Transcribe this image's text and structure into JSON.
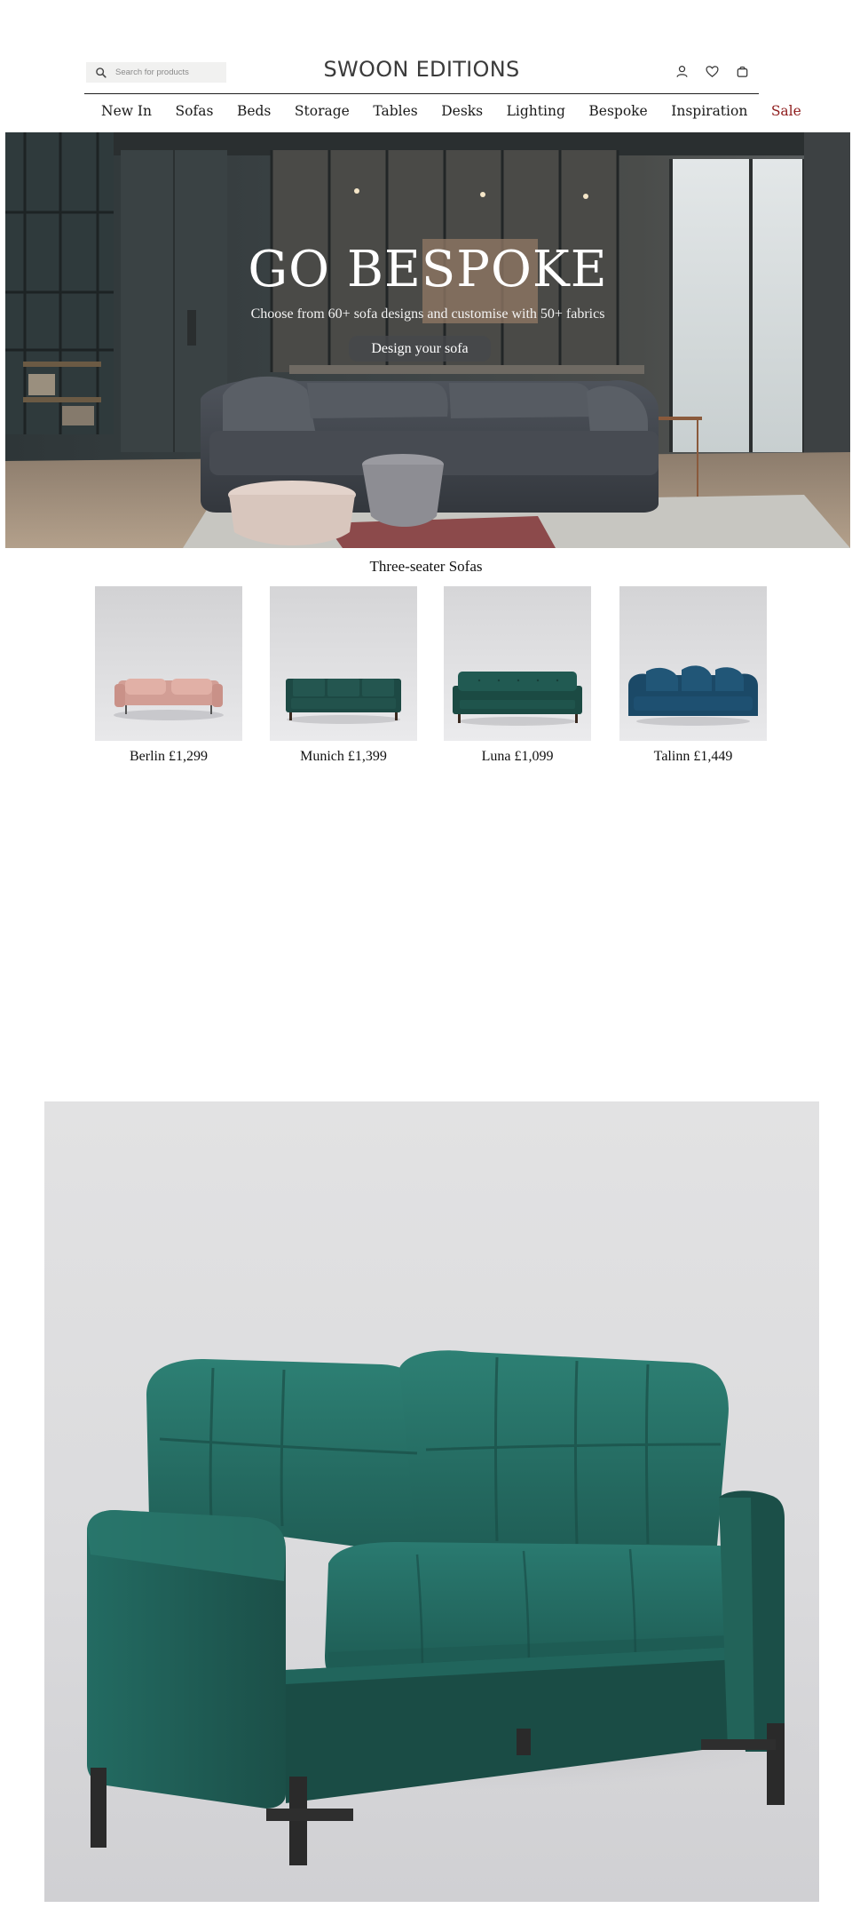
{
  "header": {
    "logo": "SWOON EDITIONS",
    "search_placeholder": "Search for products",
    "icons": [
      "search-icon",
      "account-icon",
      "heart-icon",
      "bag-icon"
    ]
  },
  "nav": {
    "items": [
      "New In",
      "Sofas",
      "Beds",
      "Storage",
      "Tables",
      "Desks",
      "Lighting",
      "Bespoke",
      "Inspiration",
      "Sale"
    ]
  },
  "hero": {
    "title": "GO BESPOKE",
    "subtitle": "Choose from 60+ sofa designs and customise with 50+ fabrics",
    "button_label": "Design your sofa"
  },
  "products": {
    "section_title": "Three-seater Sofas",
    "items": [
      {
        "caption": "Berlin £1,299",
        "color": "#d6a29a"
      },
      {
        "caption": "Munich £1,399",
        "color": "#1e4a45"
      },
      {
        "caption": "Luna £1,099",
        "color": "#1d4e47"
      },
      {
        "caption": "Talinn £1,449",
        "color": "#1c4b66"
      }
    ]
  },
  "colors": {
    "sale": "#8e1b1b",
    "velvet_green": "#1f5a52",
    "background": "#ffffff"
  }
}
